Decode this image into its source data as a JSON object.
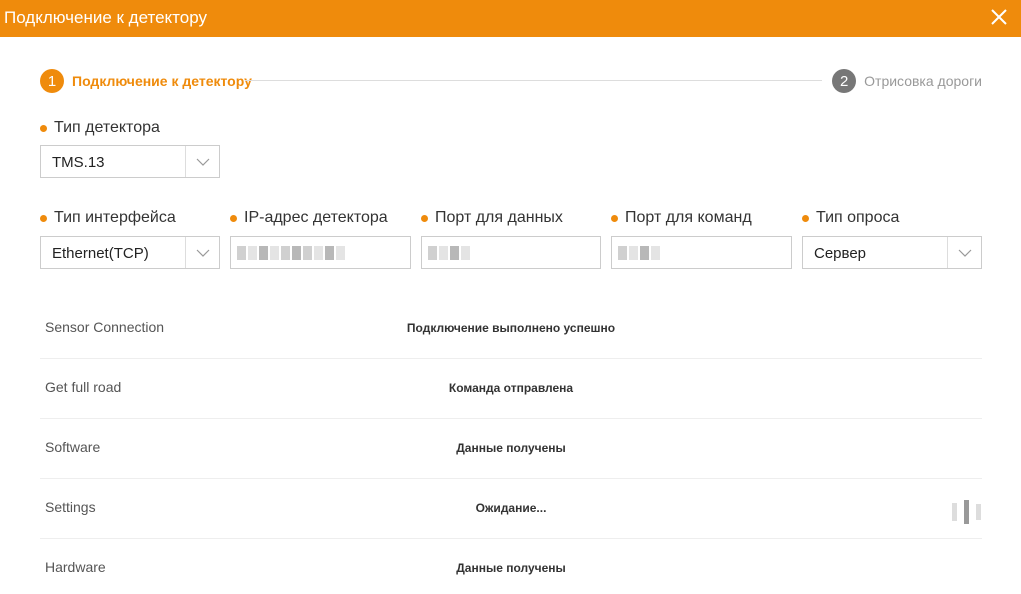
{
  "window": {
    "title": "Подключение к детектору",
    "close_icon": "close-icon"
  },
  "stepper": {
    "steps": [
      {
        "number": "1",
        "label": "Подключение к детектору",
        "active": true
      },
      {
        "number": "2",
        "label": "Отрисовка дороги",
        "active": false
      }
    ]
  },
  "form": {
    "detector_type": {
      "label": "Тип детектора",
      "value": "TMS.13"
    },
    "interface_type": {
      "label": "Тип интерфейса",
      "value": "Ethernet(TCP)"
    },
    "ip_address": {
      "label": "IP-адрес детектора",
      "value": ""
    },
    "data_port": {
      "label": "Порт для данных",
      "value": ""
    },
    "command_port": {
      "label": "Порт для команд",
      "value": ""
    },
    "poll_type": {
      "label": "Тип опроса",
      "value": "Сервер"
    }
  },
  "status": {
    "rows": [
      {
        "name": "Sensor Connection",
        "state": "Подключение выполнено успешно"
      },
      {
        "name": "Get full road",
        "state": "Команда отправлена"
      },
      {
        "name": "Software",
        "state": "Данные получены"
      },
      {
        "name": "Settings",
        "state": "Ожидание..."
      },
      {
        "name": "Hardware",
        "state": "Данные получены"
      }
    ]
  },
  "colors": {
    "accent": "#ef8b0c",
    "inactive_step": "#777777"
  }
}
